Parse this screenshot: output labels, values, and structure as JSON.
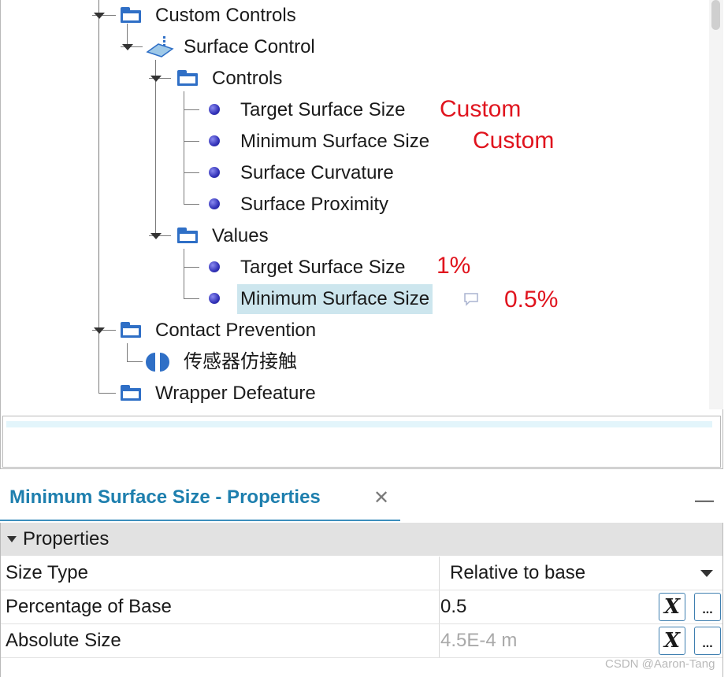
{
  "tree": {
    "custom_controls": "Custom Controls",
    "surface_control": "Surface Control",
    "controls": "Controls",
    "controls_items": [
      "Target Surface Size",
      "Minimum Surface Size",
      "Surface Curvature",
      "Surface Proximity"
    ],
    "values": "Values",
    "values_items": [
      "Target Surface Size",
      "Minimum Surface Size"
    ],
    "contact_prevention": "Contact Prevention",
    "sensor_contact": "传感器仿接触",
    "wrapper_defeature": "Wrapper Defeature"
  },
  "annotations": {
    "target_custom": "Custom",
    "minimum_custom": "Custom",
    "target_value": "1%",
    "minimum_value": "0.5%"
  },
  "properties": {
    "title": "Minimum Surface Size - Properties",
    "close": "✕",
    "minimize": "—",
    "section": "Properties",
    "rows": [
      {
        "key": "Size Type",
        "value": "Relative to base"
      },
      {
        "key": "Percentage of Base",
        "value": "0.5"
      },
      {
        "key": "Absolute Size",
        "value": "4.5E-4 m"
      }
    ],
    "expr_button": "X",
    "more_button": "..."
  },
  "watermark": "CSDN @Aaron-Tang",
  "colors": {
    "annotation": "#e0141e",
    "title": "#1e7fae",
    "selection": "#cde6ee"
  }
}
